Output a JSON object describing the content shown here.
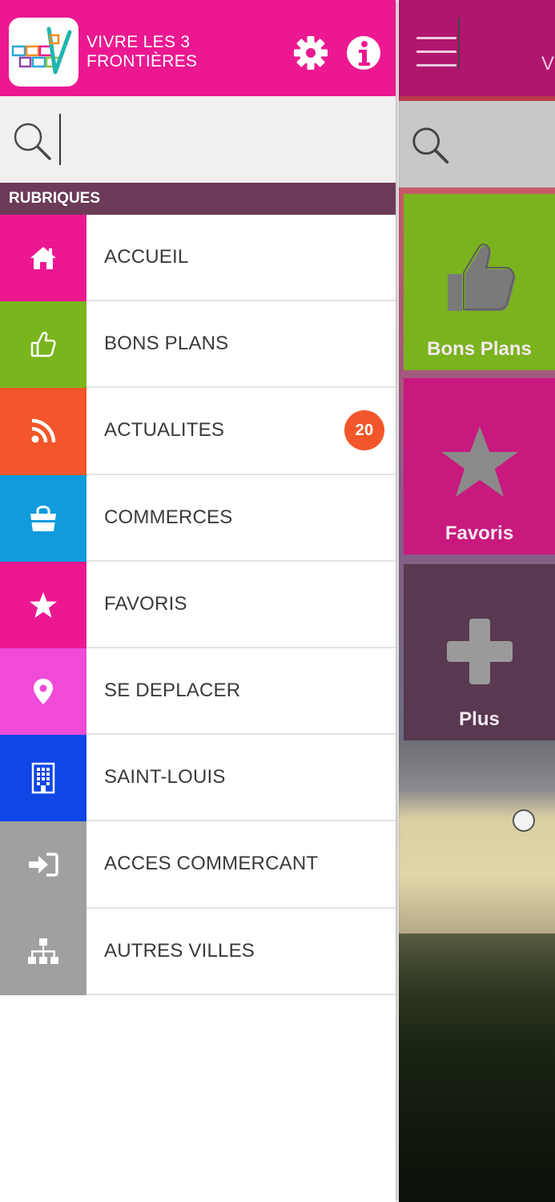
{
  "drawer": {
    "app_title_line1": "VIVRE LES 3",
    "app_title_line2": "FRONTIÈRES",
    "search": {
      "value": "",
      "placeholder": ""
    },
    "section_title": "RUBRIQUES",
    "items": [
      {
        "label": "ACCUEIL",
        "icon": "home-icon",
        "color": "#ec1891"
      },
      {
        "label": "BONS PLANS",
        "icon": "thumbs-up-icon",
        "color": "#7ab51d"
      },
      {
        "label": "ACTUALITES",
        "icon": "rss-icon",
        "color": "#f2562a",
        "badge": "20"
      },
      {
        "label": "COMMERCES",
        "icon": "shopping-bag-icon",
        "color": "#109bdd"
      },
      {
        "label": "FAVORIS",
        "icon": "star-icon",
        "color": "#ec1891"
      },
      {
        "label": "SE DEPLACER",
        "icon": "map-marker-icon",
        "color": "#ef4bd8"
      },
      {
        "label": "SAINT-LOUIS",
        "icon": "building-icon",
        "color": "#1045e6"
      },
      {
        "label": "ACCES COMMERCANT",
        "icon": "sign-in-icon",
        "color": "#a0a0a0"
      },
      {
        "label": "AUTRES VILLES",
        "icon": "sitemap-icon",
        "color": "#a0a0a0"
      }
    ]
  },
  "background": {
    "header_title_fragment": "V",
    "tiles": [
      {
        "label": "Bons Plans",
        "icon": "thumbs-up-icon"
      },
      {
        "label": "Favoris",
        "icon": "star-icon"
      },
      {
        "label": "Plus",
        "icon": "plus-icon"
      }
    ]
  },
  "colors": {
    "drawer_header": "#ec1891",
    "section_header": "#6b3b57",
    "badge": "#f2562a",
    "background_header": "#b0166e"
  }
}
